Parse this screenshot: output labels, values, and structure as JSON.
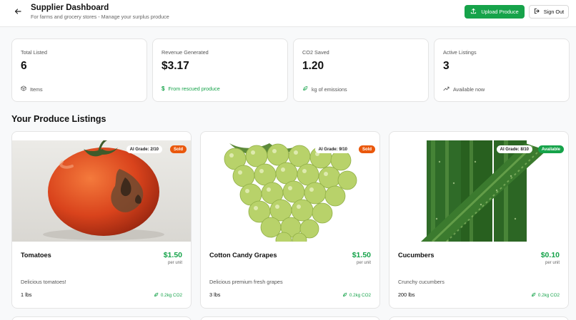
{
  "header": {
    "title": "Supplier Dashboard",
    "subtitle": "For farms and grocery stores - Manage your surplus produce",
    "upload_label": "Upload Produce",
    "signout_label": "Sign Out"
  },
  "stats": [
    {
      "label": "Total Listed",
      "value": "6",
      "footer": "Items",
      "icon": "box-icon"
    },
    {
      "label": "Revenue Generated",
      "value": "$3.17",
      "footer": "From rescued produce",
      "icon": "dollar-icon"
    },
    {
      "label": "CO2 Saved",
      "value": "1.20",
      "footer": "kg of emissions",
      "icon": "leaf-icon"
    },
    {
      "label": "Active Listings",
      "value": "3",
      "footer": "Available now",
      "icon": "trend-up-icon"
    }
  ],
  "section_title": "Your Produce Listings",
  "listings": [
    {
      "name": "Tomatoes",
      "price": "$1.50",
      "unit": "per unit",
      "description": "Delicious tomatoes!",
      "quantity": "1 lbs",
      "co2": "0.2kg CO2",
      "grade": "AI Grade: 2/10",
      "status": "Sold"
    },
    {
      "name": "Cotton Candy Grapes",
      "price": "$1.50",
      "unit": "per unit",
      "description": "Delicious premium fresh grapes",
      "quantity": "3 lbs",
      "co2": "0.2kg CO2",
      "grade": "AI Grade: 9/10",
      "status": "Sold"
    },
    {
      "name": "Cucumbers",
      "price": "$0.10",
      "unit": "per unit",
      "description": "Crunchy cucumbers",
      "quantity": "200 lbs",
      "co2": "0.2kg CO2",
      "grade": "AI Grade: 8/10",
      "status": "Available"
    }
  ],
  "colors": {
    "accent": "#16a34a",
    "sold": "#ea580c",
    "background": "#f8f9fa"
  }
}
